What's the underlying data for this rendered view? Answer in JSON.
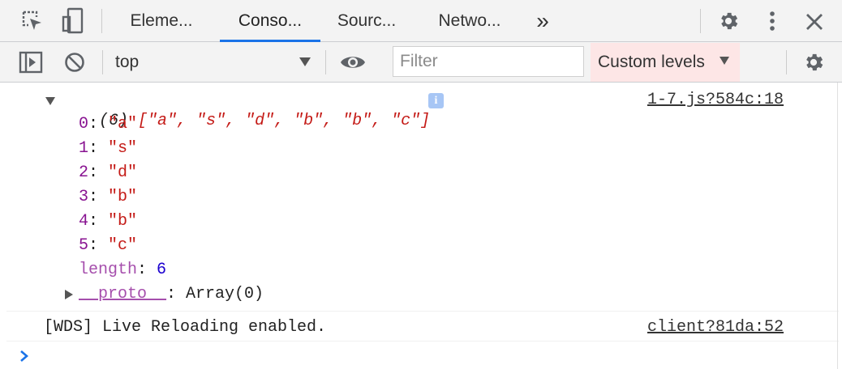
{
  "tabs": {
    "items": [
      {
        "label": "Eleme..."
      },
      {
        "label": "Conso..."
      },
      {
        "label": "Sourc..."
      },
      {
        "label": "Netwo..."
      }
    ],
    "more_label": "»"
  },
  "toolbar": {
    "context": "top",
    "filter_placeholder": "Filter",
    "levels_label": "Custom levels"
  },
  "console": {
    "array_summary": {
      "count": "(6)",
      "preview": "[\"a\", \"s\", \"d\", \"b\", \"b\", \"c\"]",
      "source": "1-7.js?584c:18"
    },
    "entries": [
      {
        "key": "0",
        "value": "\"a\""
      },
      {
        "key": "1",
        "value": "\"s\""
      },
      {
        "key": "2",
        "value": "\"d\""
      },
      {
        "key": "3",
        "value": "\"b\""
      },
      {
        "key": "4",
        "value": "\"b\""
      },
      {
        "key": "5",
        "value": "\"c\""
      }
    ],
    "length_key": "length",
    "length_value": "6",
    "proto_key": "__proto__",
    "proto_value": "Array(0)",
    "log_message": "[WDS] Live Reloading enabled.",
    "log_source": "client?81da:52"
  },
  "colors": {
    "accent": "#1a73e8",
    "key": "#881391",
    "string": "#c41a16",
    "number": "#1c00cf",
    "levels_bg": "#fde6e6"
  }
}
